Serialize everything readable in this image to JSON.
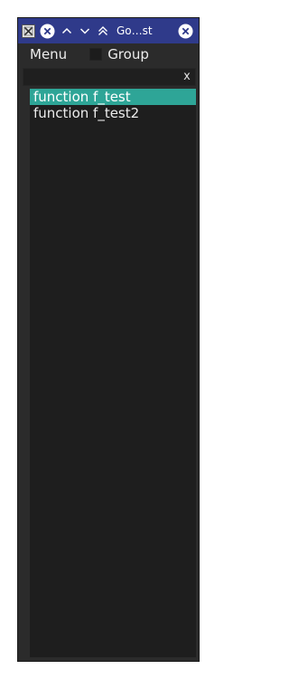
{
  "window": {
    "title": "Go…st"
  },
  "menubar": {
    "menu_label": "Menu",
    "group_label": "Group",
    "group_checked": false
  },
  "search": {
    "value": "",
    "clear_label": "x"
  },
  "list": {
    "items": [
      {
        "label": "function f_test",
        "selected": true
      },
      {
        "label": "function f_test2",
        "selected": false
      }
    ]
  },
  "colors": {
    "titlebar": "#2f3a8a",
    "selection": "#2ea597",
    "panel": "#2b2b2b",
    "list_bg": "#1e1e1e"
  }
}
